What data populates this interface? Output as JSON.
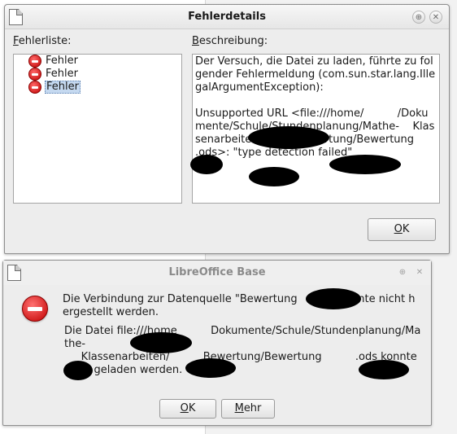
{
  "error_details_dialog": {
    "title": "Fehlerdetails",
    "rollup_glyph": "⊕",
    "close_glyph": "✕",
    "error_list_label_accel": "F",
    "error_list_label_rest": "ehlerliste:",
    "description_label_accel": "B",
    "description_label_rest": "eschreibung:",
    "errors": [
      {
        "label": "Fehler",
        "selected": false
      },
      {
        "label": "Fehler",
        "selected": false
      },
      {
        "label": "Fehler",
        "selected": true
      }
    ],
    "description": "Der Versuch, die Datei zu laden, führte zu folgender Fehlermeldung (com.sun.star.lang.IllegalArgumentException):\n\nUnsupported URL <file:///home/          /Dokumente/Schule/Stundenplanung/Mathe-    Klassenarbeiten/          Bewertung/Bewertung          .ods>: \"type detection failed\"",
    "ok_accel": "O",
    "ok_rest": "K"
  },
  "base_dialog": {
    "title": "LibreOffice Base",
    "rollup_glyph": "⊕",
    "close_glyph": "✕",
    "message": "Die Verbindung zur Datenquelle \"Bewertung          \" konnte nicht hergestellt werden.",
    "detail": "Die Datei file:///home          Dokumente/Schule/Stundenplanung/Mathe-\n     Klassenarbeiten/          Bewertung/Bewertung          .ods konnte nicht geladen werden.",
    "ok_accel": "O",
    "ok_rest": "K",
    "more_accel": "M",
    "more_rest": "ehr"
  }
}
